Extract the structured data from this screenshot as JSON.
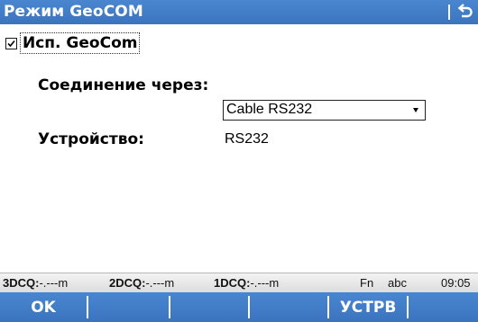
{
  "window": {
    "title": "Режим GeoCOM",
    "back_icon": "back-arrow-icon"
  },
  "form": {
    "use_geocom": {
      "label": "Исп. GeoCom",
      "checked": true
    },
    "connection_label": "Соединение через:",
    "connection_value": "Cable RS232",
    "device_label": "Устройство:",
    "device_value": "RS232"
  },
  "status": {
    "dcq3_label": "3DCQ:",
    "dcq3_value": "-.---m",
    "dcq2_label": "2DCQ:",
    "dcq2_value": "-.---m",
    "dcq1_label": "1DCQ:",
    "dcq1_value": "-.---m",
    "fn": "Fn",
    "input_mode": "abc",
    "time": "09:05"
  },
  "softkeys": {
    "f1": "OK",
    "f2": "",
    "f3": "",
    "f4": "",
    "f5": "УСТРВ",
    "f6": ""
  },
  "colors": {
    "bar_blue": "#3b74be",
    "statusbar_gray": "#e6e6e6"
  }
}
